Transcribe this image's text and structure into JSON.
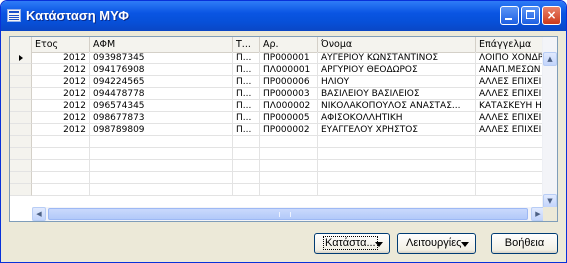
{
  "window": {
    "title": "Κατάσταση ΜΥΦ"
  },
  "titlebar_buttons": {
    "minimize": "",
    "maximize": "",
    "close": "×"
  },
  "table": {
    "columns": [
      "Ετος",
      "ΑΦΜ",
      "Τ...",
      "Αρ.",
      "Όνομα",
      "Επάγγελμα"
    ],
    "rows": [
      [
        "2012",
        "093987345",
        "Π...",
        "ΠΡ000001",
        "ΑΥΓΕΡΙΟΥ ΚΩΝΣΤΑΝΤΙΝΟΣ",
        "ΛΟΙΠΟ ΧΟΝΔΡ"
      ],
      [
        "2012",
        "094176908",
        "Π...",
        "ΠΛ000001",
        "ΑΡΓΥΡΙΟΥ ΘΕΟΔΩΡΟΣ",
        "ΑΝΑΠ.ΜΕΣΩΝ"
      ],
      [
        "2012",
        "094224565",
        "Π...",
        "ΠΡ000006",
        "ΗΛΙΟΥ",
        "ΑΛΛΕΣ ΕΠΙΧΕΙΙ"
      ],
      [
        "2012",
        "094478778",
        "Π...",
        "ΠΡ000003",
        "ΒΑΣΙΛΕΙΟΥ ΒΑΣΙΛΕΙΟΣ",
        "ΑΛΛΕΣ ΕΠΙΧΕΙΙ"
      ],
      [
        "2012",
        "096574345",
        "Π...",
        "ΠΛ000002",
        "ΝΙΚΟΛΑΚΟΠΟΥΛΟΣ ΑΝΑΣΤΑΣ...",
        "ΚΑΤΑΣΚΕΥΗ Η/"
      ],
      [
        "2012",
        "098677873",
        "Π...",
        "ΠΡ000005",
        "ΑΦΙΣΟΚΟΛΛΗΤΙΚΗ",
        "ΑΛΛΕΣ ΕΠΙΧΕΙΙ"
      ],
      [
        "2012",
        "098789809",
        "Π...",
        "ΠΡ000002",
        "ΕΥΑΓΓΕΛΟΥ ΧΡΗΣΤΟΣ",
        "ΑΛΛΕΣ ΕΠΙΧΕΙΙ"
      ]
    ],
    "selected_row": 0
  },
  "scrollbars": {
    "up": "▲",
    "down": "▼",
    "left": "◀",
    "right": "▶"
  },
  "buttons": {
    "status": "Κατάστα...",
    "functions": "Λειτουργίες",
    "help": "Βοήθεια"
  },
  "colors": {
    "titlebar": "#0a55e3",
    "close_button": "#cc3a1b",
    "selection_arrow": "#000000"
  }
}
